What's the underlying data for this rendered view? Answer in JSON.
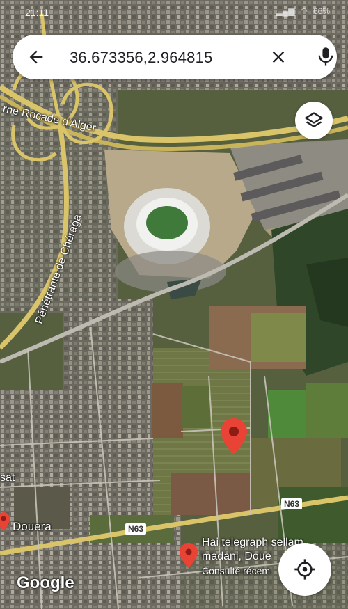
{
  "status_bar": {
    "time": "21:11",
    "battery": "66%"
  },
  "search": {
    "query": "36.673356,2.964815"
  },
  "map": {
    "labels": {
      "rocade": "rne Rocade d'Alger",
      "cheraga": "Pénétrante de Chéraga",
      "douera": "Douera",
      "sat": "sat",
      "n63_a": "N63",
      "n63_b": "N63",
      "place_line1": "Hai telegraph sellam",
      "place_line2": "madani, Doue",
      "place_line3": "Consulté récem"
    }
  },
  "attribution": "Google",
  "colors": {
    "pin": "#e94335",
    "road": "#d9c46a"
  }
}
